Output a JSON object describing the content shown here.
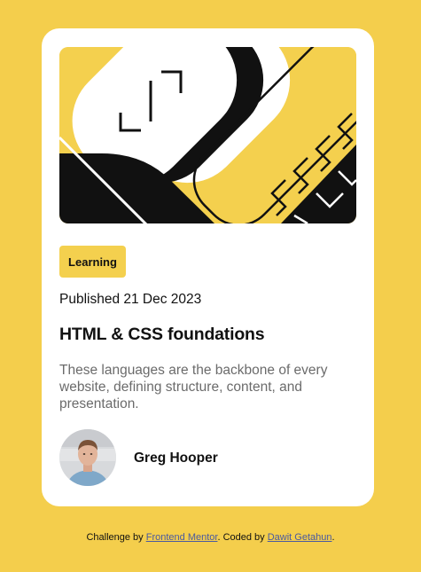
{
  "card": {
    "tag": "Learning",
    "published": "Published 21 Dec 2023",
    "title": "HTML & CSS foundations",
    "description": "These languages are the backbone of every website, defining structure, content, and presentation.",
    "author": "Greg Hooper"
  },
  "footer": {
    "challenge_prefix": "Challenge by ",
    "challenge_link": "Frontend Mentor",
    "coded_prefix": ". Coded by ",
    "coded_link": "Dawit Getahun",
    "suffix": "."
  },
  "colors": {
    "background": "#F4CE4C",
    "card": "#FFFFFF",
    "accent": "#F4D04E",
    "text": "#111111",
    "muted": "#6B6B6B"
  },
  "icons": {
    "hero": "abstract-illustration",
    "avatar": "person-photo"
  }
}
